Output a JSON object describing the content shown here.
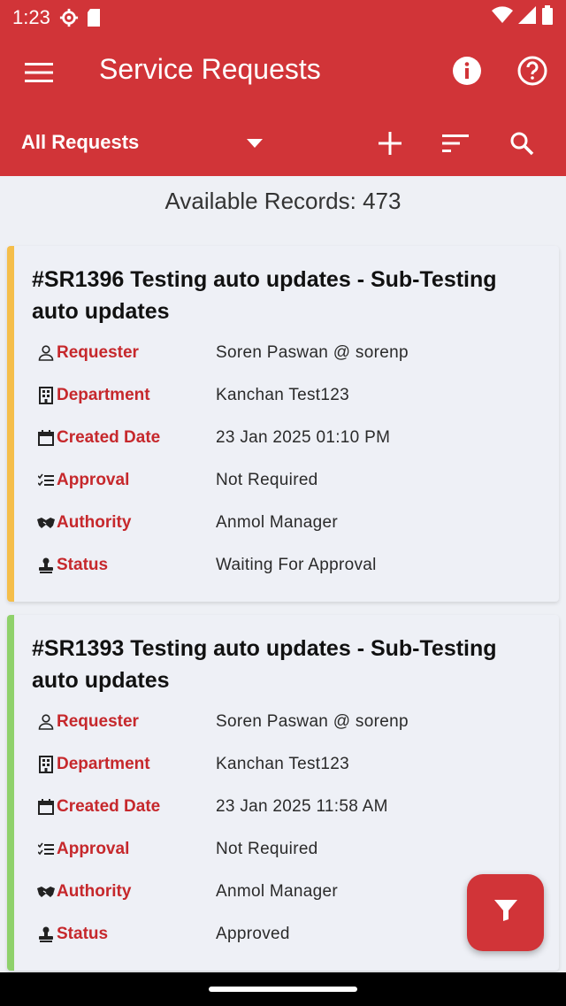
{
  "status_bar": {
    "time": "1:23",
    "icons": [
      "settings-gear-icon",
      "sd-card-icon",
      "wifi-icon",
      "signal-icon",
      "battery-icon"
    ]
  },
  "app_bar": {
    "title": "Service Requests",
    "menu_icon": "hamburger-menu-icon",
    "info_icon": "info-icon",
    "help_icon": "help-icon"
  },
  "toolbar": {
    "filter_value": "All Requests",
    "add_icon": "plus-icon",
    "sort_icon": "sort-icon",
    "search_icon": "search-icon"
  },
  "records_label": "Available Records: 473",
  "labels": {
    "requester": "Requester",
    "department": "Department",
    "created_date": "Created Date",
    "approval": "Approval",
    "authority": "Authority",
    "status": "Status"
  },
  "cards": [
    {
      "title": "#SR1396 Testing auto updates - Sub-Testing auto updates",
      "requester": "Soren Paswan @ sorenp",
      "department": "Kanchan Test123",
      "created_date": "23 Jan 2025 01:10 PM",
      "approval": "Not Required",
      "authority": "Anmol Manager",
      "status": "Waiting For Approval",
      "accent": "#f5be4a"
    },
    {
      "title": "#SR1393 Testing auto updates - Sub-Testing auto updates",
      "requester": "Soren Paswan @ sorenp",
      "department": "Kanchan Test123",
      "created_date": "23 Jan 2025 11:58 AM",
      "approval": "Not Required",
      "authority": "Anmol Manager",
      "status": "Approved",
      "accent": "#8fd16b"
    }
  ],
  "fab_icon": "filter-icon",
  "colors": {
    "brand": "#d13438",
    "label": "#c6282c"
  }
}
